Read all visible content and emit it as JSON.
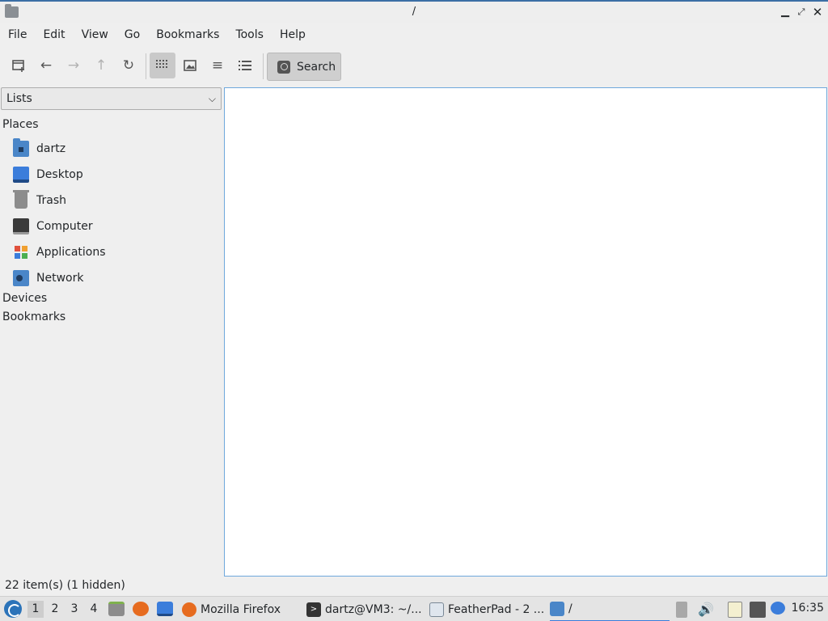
{
  "window": {
    "title": "/"
  },
  "menu": [
    "File",
    "Edit",
    "View",
    "Go",
    "Bookmarks",
    "Tools",
    "Help"
  ],
  "toolbar": {
    "search_label": "Search",
    "buttons": [
      "new-tab-icon",
      "back-arrow-icon",
      "forward-arrow-icon",
      "up-arrow-icon",
      "reload-icon",
      "icon-view-icon",
      "thumbnail-view-icon",
      "compact-view-icon",
      "detailed-list-view-icon"
    ]
  },
  "sidebar": {
    "mode": "Lists",
    "places_label": "Places",
    "places": [
      {
        "label": "dartz",
        "icon": "home-folder-icon"
      },
      {
        "label": "Desktop",
        "icon": "desktop-icon"
      },
      {
        "label": "Trash",
        "icon": "trash-icon"
      },
      {
        "label": "Computer",
        "icon": "computer-icon"
      },
      {
        "label": "Applications",
        "icon": "applications-icon"
      },
      {
        "label": "Network",
        "icon": "network-icon"
      }
    ],
    "devices_label": "Devices",
    "bookmarks_label": "Bookmarks"
  },
  "status": {
    "text": "22 item(s) (1 hidden)"
  },
  "taskbar": {
    "workspaces": [
      "1",
      "2",
      "3",
      "4"
    ],
    "active_workspace": "1",
    "tasks": [
      {
        "label": "Mozilla Firefox",
        "icon": "firefox-icon"
      },
      {
        "label": "dartz@VM3: ~/...",
        "icon": "terminal-icon"
      },
      {
        "label": "FeatherPad - 2 ...",
        "icon": "featherpad-icon"
      },
      {
        "label": "/",
        "icon": "folder-icon"
      }
    ],
    "clock": "16:35"
  },
  "colors": {
    "accent": "#3b7ddb",
    "title_accent": "#3b6ea5",
    "folder": "#4a86c8"
  }
}
